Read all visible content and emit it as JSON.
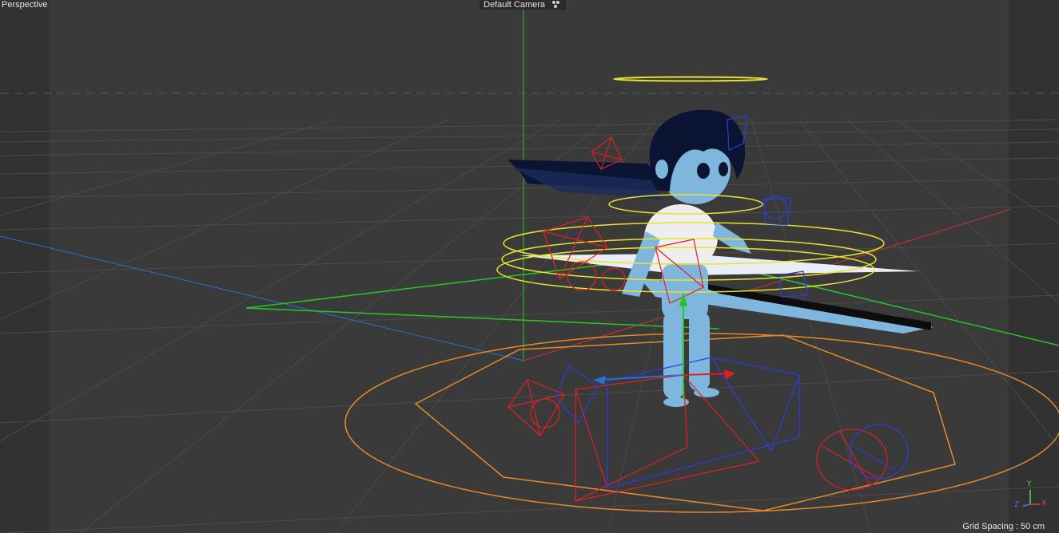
{
  "viewport": {
    "view_name": "Perspective",
    "camera": "Default Camera",
    "camera_icon": "camera-rig-icon",
    "grid_spacing": "Grid Spacing : 50 cm"
  },
  "axis_gizmo": {
    "x": "X",
    "y": "Y",
    "z": "Z"
  },
  "colors": {
    "background": "#3a3a3a",
    "safe_frame_dark": "#2f2f2f",
    "grid": "#4a4a4a",
    "axis_y": "#27c627",
    "axis_x": "#d33",
    "axis_z": "#2a6fd6",
    "spline_yellow": "#e9e330",
    "spline_orange": "#e58a2a",
    "joint_red": "#e02020",
    "joint_blue": "#2a3ee0",
    "character_skin": "#7fb6dd",
    "character_hair": "#0b1432"
  }
}
